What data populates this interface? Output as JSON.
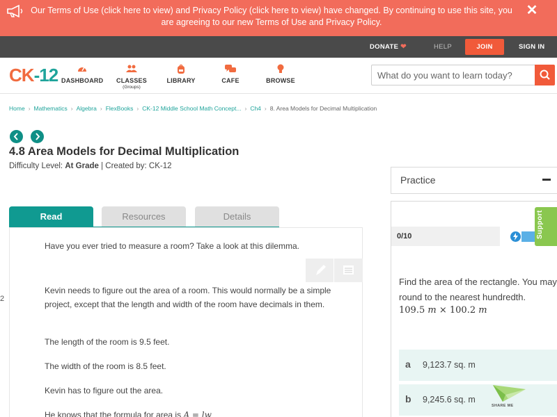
{
  "banner": {
    "text_1": "Our Terms of Use (click ",
    "link_1": "here",
    "text_2": " to view) and Privacy Policy (click ",
    "link_2": "here",
    "text_3": " to view) have changed. By continuing to use this site, you are agreeing to our new Terms of Use and Privacy Policy.",
    "close_label": "✕",
    "icon": "megaphone-icon"
  },
  "topbar": {
    "donate": "DONATE",
    "help": "HELP",
    "join": "JOIN",
    "sign_in": "SIGN IN"
  },
  "navbar": {
    "logo_c": "CK",
    "logo_dash": "-",
    "logo_12": "12",
    "items": [
      {
        "label": "DASHBOARD",
        "icon": "dashboard-icon"
      },
      {
        "label": "CLASSES",
        "sub": "(Groups)",
        "icon": "users-icon"
      },
      {
        "label": "LIBRARY",
        "icon": "backpack-icon"
      },
      {
        "label": "CAFE",
        "icon": "chat-icon"
      },
      {
        "label": "BROWSE",
        "icon": "lightbulb-icon"
      }
    ],
    "search_placeholder": "What do you want to learn today?"
  },
  "breadcrumb": [
    "Home",
    "Mathematics",
    "Algebra",
    "FlexBooks",
    "CK-12 Middle School Math Concept...",
    "Ch4",
    "8. Area Models for Decimal Multiplication"
  ],
  "page": {
    "title": "4.8 Area Models for Decimal Multiplication",
    "difficulty_label": "Difficulty Level: ",
    "difficulty_value": "At Grade",
    "created_by": " | Created by: CK-12"
  },
  "tabs": [
    "Read",
    "Resources",
    "Details"
  ],
  "content": {
    "paragraphs": [
      "Have you ever tried to measure a room? Take a look at this dilemma.",
      "Kevin needs to figure out the area of a room. This would normally be a simple project, except that the length and width of the room have decimals in them.",
      "The length of the room is 9.5 feet.",
      "The width of the room is 8.5 feet.",
      "Kevin has to figure out the area.",
      "He knows that the formula for area is "
    ],
    "formula": "A = lw"
  },
  "left_glyph": "2",
  "practice": {
    "label": "Practice",
    "score": "0/10",
    "support": "Support",
    "question": "Find the area of the rectangle. You may round to the nearest hundredth.",
    "math_a": "109.5",
    "math_unit1": "m",
    "math_times": "×",
    "math_b": "100.2",
    "math_unit2": "m",
    "answers": [
      {
        "letter": "a",
        "text": "9,123.7 sq. m"
      },
      {
        "letter": "b",
        "text": "9,245.6 sq. m"
      }
    ],
    "share": "SHARE ME"
  },
  "colors": {
    "banner": "#f26c5b",
    "topbar": "#4a4a4a",
    "accent_teal": "#109a91",
    "accent_orange": "#f15a3a",
    "support_green": "#8ac74f",
    "answer_bg": "#e8f5f3"
  }
}
